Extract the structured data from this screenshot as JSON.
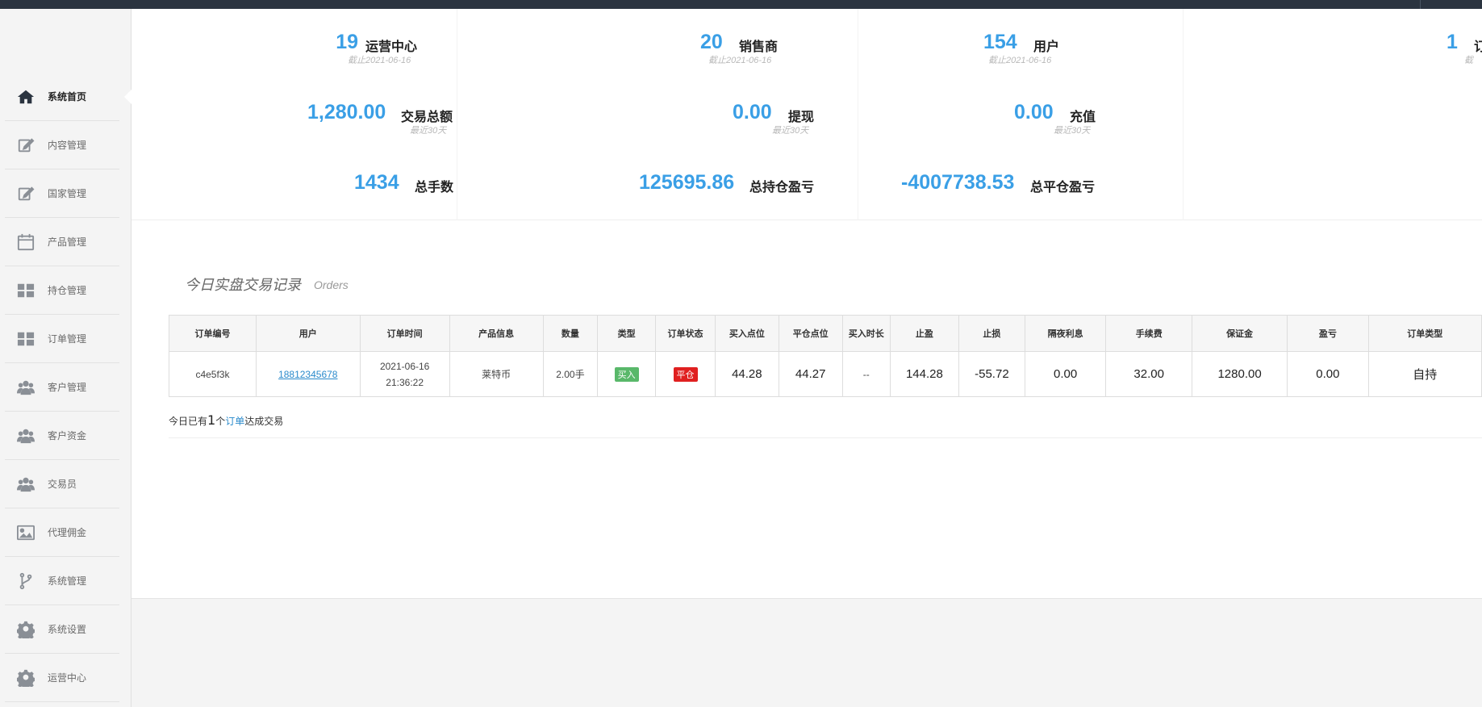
{
  "sidebar": {
    "items": [
      {
        "label": "系统首页",
        "icon": "home-icon",
        "active": true
      },
      {
        "label": "内容管理",
        "icon": "edit-icon"
      },
      {
        "label": "国家管理",
        "icon": "edit-icon"
      },
      {
        "label": "产品管理",
        "icon": "calendar-icon"
      },
      {
        "label": "持仓管理",
        "icon": "grid-icon"
      },
      {
        "label": "订单管理",
        "icon": "grid-icon"
      },
      {
        "label": "客户管理",
        "icon": "users-icon"
      },
      {
        "label": "客户资金",
        "icon": "users-icon"
      },
      {
        "label": "交易员",
        "icon": "users-icon"
      },
      {
        "label": "代理佣金",
        "icon": "image-icon"
      },
      {
        "label": "系统管理",
        "icon": "branch-icon"
      },
      {
        "label": "系统设置",
        "icon": "gear-icon"
      },
      {
        "label": "运营中心",
        "icon": "gear-icon"
      }
    ]
  },
  "stats": {
    "row1": [
      {
        "value": "19",
        "label": "运营中心",
        "sub": "截止2021-06-16"
      },
      {
        "value": "20",
        "label": "销售商",
        "sub": "截止2021-06-16"
      },
      {
        "value": "154",
        "label": "用户",
        "sub": "截止2021-06-16"
      },
      {
        "value": "1",
        "label": "订",
        "sub": "截"
      }
    ],
    "row2": [
      {
        "value": "1,280.00",
        "label": "交易总额",
        "sub": "最近30天"
      },
      {
        "value": "0.00",
        "label": "提现",
        "sub": "最近30天"
      },
      {
        "value": "0.00",
        "label": "充值",
        "sub": "最近30天"
      }
    ],
    "row3": [
      {
        "value": "1434",
        "label": "总手数"
      },
      {
        "value": "125695.86",
        "label": "总持仓盈亏"
      },
      {
        "value": "-4007738.53",
        "label": "总平仓盈亏"
      }
    ]
  },
  "orders": {
    "title": "今日实盘交易记录",
    "subtitle": "Orders",
    "columns": [
      "订单编号",
      "用户",
      "订单时间",
      "产品信息",
      "数量",
      "类型",
      "订单状态",
      "买入点位",
      "平仓点位",
      "买入时长",
      "止盈",
      "止损",
      "隔夜利息",
      "手续费",
      "保证金",
      "盈亏",
      "订单类型"
    ],
    "rows": [
      {
        "id": "c4e5f3k",
        "user": "18812345678",
        "date": "2021-06-16",
        "time": "21:36:22",
        "product": "莱特币",
        "qty": "2.00手",
        "type": "买入",
        "status": "平仓",
        "buy_price": "44.28",
        "close_price": "44.27",
        "duration": "--",
        "take_profit": "144.28",
        "stop_loss": "-55.72",
        "overnight": "0.00",
        "fee": "32.00",
        "margin": "1280.00",
        "pnl": "0.00",
        "order_type": "自持"
      }
    ],
    "summary": {
      "prefix": "今日已有",
      "count": "1",
      "mid": "个",
      "link": "订单",
      "suffix": "达成交易"
    }
  },
  "colors": {
    "accent": "#3a9fe6",
    "topbar": "#2b3440",
    "buy_badge": "#59b86a",
    "closed_badge": "#e02020",
    "link": "#2a8acb"
  }
}
